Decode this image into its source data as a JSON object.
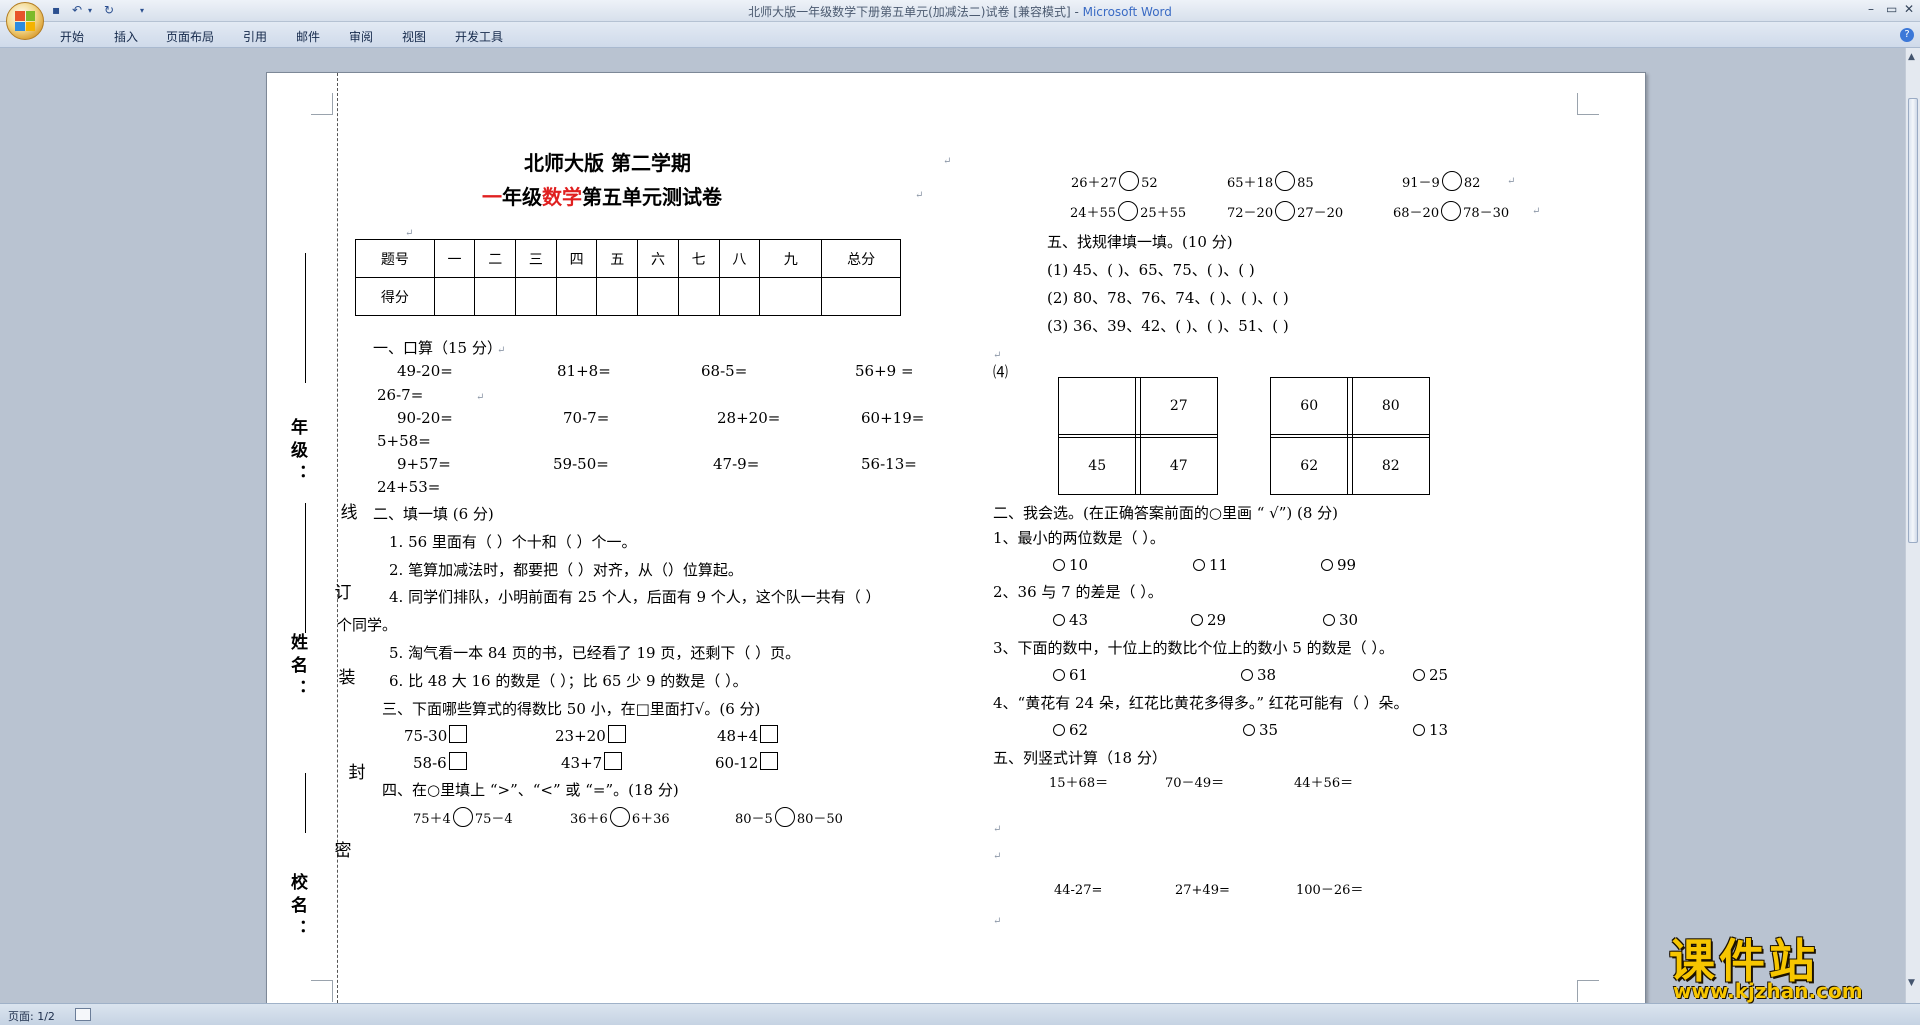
{
  "window": {
    "title": "北师大版一年级数学下册第五单元(加减法二)试卷 [兼容模式] - ",
    "app": "Microsoft Word",
    "minimize": "–",
    "restore": "▭",
    "close": "✕"
  },
  "ribbon": {
    "tabs": [
      "开始",
      "插入",
      "页面布局",
      "引用",
      "邮件",
      "审阅",
      "视图",
      "开发工具"
    ],
    "help": "?"
  },
  "status": {
    "page": "页面: 1/2"
  },
  "watermark": {
    "main": "课件站",
    "url": "www.kjzhan.com"
  },
  "doc": {
    "title1": "北师大版  第二学期",
    "title2_a": "一",
    "title2_b": "年级",
    "title2_c": "数学",
    "title2_d": "第五单元测试卷",
    "score_table": {
      "row1": [
        "题号",
        "一",
        "二",
        "三",
        "四",
        "五",
        "六",
        "七",
        "八",
        "九",
        "总分"
      ],
      "row2_label": "得分"
    },
    "sidebar": {
      "school": "校  名  ：",
      "name": "姓  名  ：",
      "grade": "年  级  ：",
      "bind_line": [
        "密",
        "封",
        "装",
        "订",
        "线"
      ]
    },
    "s1": {
      "title": "一、口算（15 分）",
      "r1": [
        "49-20=",
        "81+8=",
        "68-5=",
        "56+9  ="
      ],
      "r1b": "26-7=",
      "r2": [
        "90-20=",
        "70-7=",
        "28+20=",
        "60+19="
      ],
      "r2b": "5+58=",
      "r3": [
        "9+57=",
        "59-50=",
        "47-9=",
        "56-13="
      ],
      "r3b": "24+53="
    },
    "s2": {
      "title": "二、填一填 (6 分)",
      "q1": "1. 56 里面有（   ）个十和（   ）个一。",
      "q2": "2. 笔算加减法时，都要把（ ）对齐，从（）位算起。",
      "q4": "4.  同学们排队，小明前面有 25 个人，后面有 9 个人，这个队一共有（    ）",
      "q4b": "个同学。",
      "q5": "5.  淘气看一本 84 页的书，已经看了 19 页，还剩下（ ）页。",
      "q6": "6.  比 48 大 16 的数是（   ）；比 65 少 9 的数是（   ）。"
    },
    "s3": {
      "title": "三、下面哪些算式的得数比 50 小，在□里面打√。(6 分)",
      "items": [
        "75-30",
        "23+20",
        "48+4",
        "58-6",
        "43+7",
        "60-12"
      ]
    },
    "s4": {
      "title": "四、在○里填上 “>”、“<” 或 “=”。(18 分)",
      "items": [
        [
          "75＋4",
          "75－4"
        ],
        [
          "36＋6",
          "6＋36"
        ],
        [
          "80－5",
          "80－50"
        ],
        [
          "26＋27",
          "52"
        ],
        [
          "65＋18",
          "85"
        ],
        [
          "91－9",
          "82"
        ],
        [
          "24＋55",
          "25＋55"
        ],
        [
          "72－20",
          "27－20"
        ],
        [
          "68－20",
          "78－30"
        ]
      ]
    },
    "s5a": {
      "title": "五、找规律填一填。(10 分)",
      "l1": "(1)  45、(     )、65、75、(       )、(       )",
      "l2": "(2)  80、78、76、74、(   )、(   )、(   )",
      "l3": "(3)  36、39、42、(   )、(   )、51、(   )",
      "l4": "⑷"
    },
    "grid1": [
      "",
      "",
      "27",
      "",
      "",
      "",
      "45",
      "",
      "47"
    ],
    "grid2": [
      "60",
      "",
      "80",
      "",
      "",
      "",
      "62",
      "",
      "82"
    ],
    "s6": {
      "title": "二、我会选。(在正确答案前面的○里画 “ √”) (8 分)",
      "q1": "1、最小的两位数是（     ）。",
      "q1o": [
        "10",
        "11",
        "99"
      ],
      "q2": "2、36 与 7 的差是（      ）。",
      "q2o": [
        "43",
        "29",
        "30"
      ],
      "q3": "3、下面的数中，十位上的数比个位上的数小 5 的数是（      ）。",
      "q3o": [
        "61",
        "38",
        "25"
      ],
      "q4": "4、“黄花有 24 朵，红花比黄花多得多。” 红花可能有（      ）朵。",
      "q4o": [
        "62",
        "35",
        "13"
      ]
    },
    "s7": {
      "title": "五、列竖式计算（18 分）",
      "r1": [
        "15＋68＝",
        "70－49＝",
        "44＋56＝"
      ],
      "r2": [
        "44-27=",
        "27+49=",
        "100－26＝"
      ]
    },
    "para_mark": "↵"
  }
}
